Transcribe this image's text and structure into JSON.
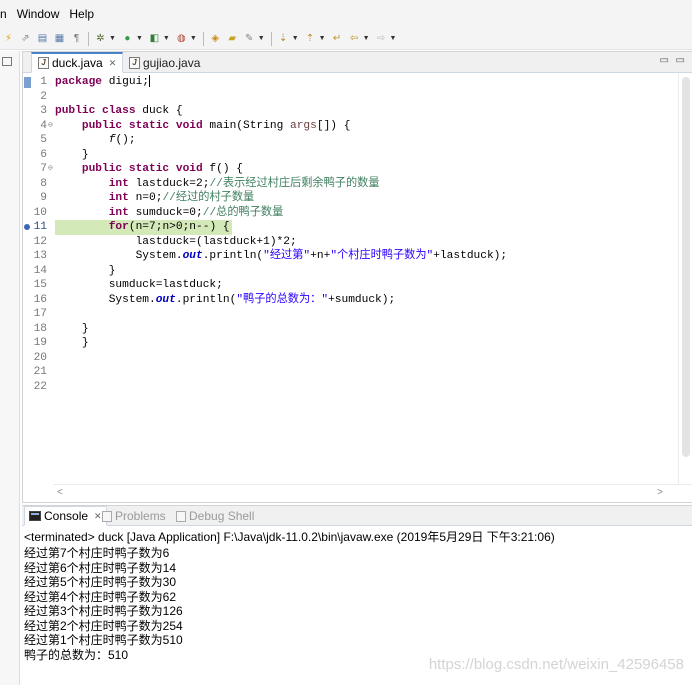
{
  "menu": [
    "n",
    "Window",
    "Help"
  ],
  "editor": {
    "tabs": [
      {
        "label": "duck.java",
        "close": "✕"
      },
      {
        "label": "gujiao.java"
      }
    ],
    "window_controls": {
      "minimize": "▭",
      "maximize": "▭"
    },
    "line_numbers": [
      "1",
      "2",
      "3",
      "4",
      "5",
      "6",
      "7",
      "8",
      "9",
      "10",
      "11",
      "12",
      "13",
      "14",
      "15",
      "16",
      "17",
      "18",
      "19",
      "20",
      "21",
      "22"
    ],
    "fold_markers": {
      "4": "⊖",
      "7": "⊖"
    },
    "current_line": "11",
    "highlighted_line": "11"
  },
  "console": {
    "tabs": {
      "console": "Console",
      "console_close": "✕",
      "problems": "Problems",
      "debug": "Debug Shell"
    },
    "terminated": "<terminated> duck [Java Application] F:\\Java\\jdk-11.0.2\\bin\\javaw.exe (2019年5月29日 下午3:21:06)",
    "output": [
      "经过第7个村庄时鸭子数为6",
      "经过第6个村庄时鸭子数为14",
      "经过第5个村庄时鸭子数为30",
      "经过第4个村庄时鸭子数为62",
      "经过第3个村庄时鸭子数为126",
      "经过第2个村庄时鸭子数为254",
      "经过第1个村庄时鸭子数为510",
      "鸭子的总数为：510"
    ],
    "watermark": "https://blog.csdn.net/weixin_42596458"
  }
}
